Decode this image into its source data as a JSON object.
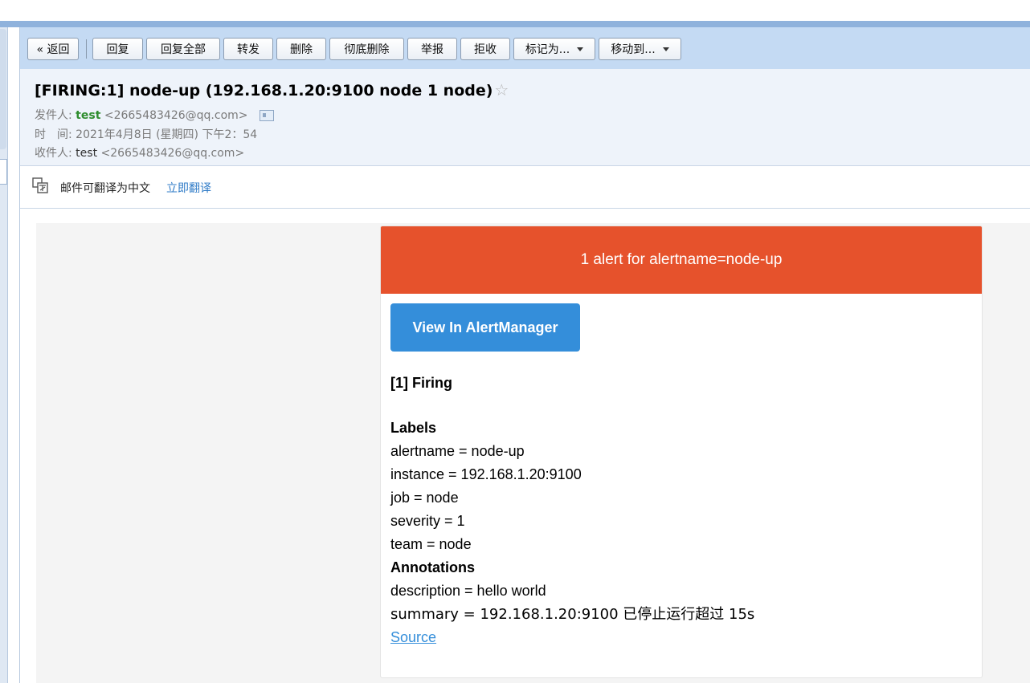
{
  "toolbar": {
    "back": "« 返回",
    "reply": "回复",
    "reply_all": "回复全部",
    "forward": "转发",
    "delete": "删除",
    "delete_permanently": "彻底删除",
    "report": "举报",
    "reject": "拒收",
    "mark_as": "标记为...",
    "move_to": "移动到..."
  },
  "email": {
    "subject": "[FIRING:1] node-up (192.168.1.20:9100 node 1 node)",
    "sender_label": "发件人:",
    "sender_name": "test",
    "sender_addr": "<2665483426@qq.com>",
    "time_label": "时　间:",
    "time_value": "2021年4月8日 (星期四) 下午2：54",
    "recipient_label": "收件人:",
    "recipient_name": "test",
    "recipient_addr": "<2665483426@qq.com>"
  },
  "translate": {
    "text": "邮件可翻译为中文",
    "link": "立即翻译"
  },
  "alert": {
    "header": "1 alert for alertname=node-up",
    "view_button": "View In AlertManager",
    "firing_title": "[1] Firing",
    "labels_title": "Labels",
    "labels": [
      "alertname = node-up",
      "instance = 192.168.1.20:9100",
      "job = node",
      "severity = 1",
      "team = node"
    ],
    "annotations_title": "Annotations",
    "annotations": [
      "description = hello world",
      "summary = 192.168.1.20:9100 已停止运行超过 15s"
    ],
    "source_link": "Source"
  },
  "colors": {
    "alert_header": "#e6522c",
    "view_button": "#348eda",
    "toolbar": "#c4daf3",
    "sender_name": "#2f8d2f"
  },
  "icons": {
    "star": "star-outline",
    "contact_card": "contact-card",
    "translate": "translate"
  }
}
